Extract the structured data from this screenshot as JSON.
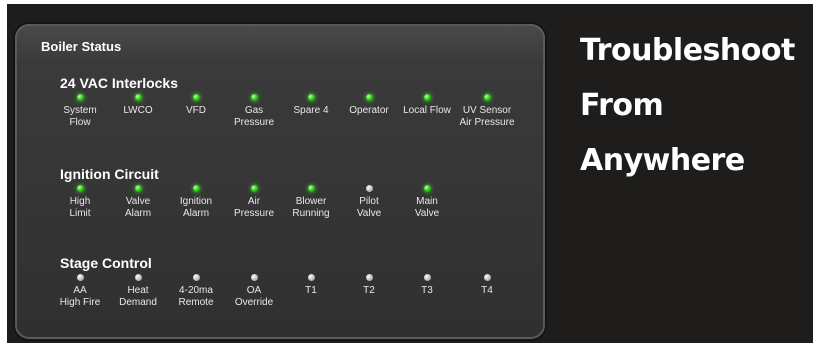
{
  "panel": {
    "title": "Boiler Status",
    "sections": [
      {
        "title": "24 VAC Interlocks",
        "items": [
          {
            "label": "System\nFlow",
            "state": "on"
          },
          {
            "label": "LWCO",
            "state": "on"
          },
          {
            "label": "VFD",
            "state": "on"
          },
          {
            "label": "Gas\nPressure",
            "state": "on"
          },
          {
            "label": "Spare 4",
            "state": "on"
          },
          {
            "label": "Operator",
            "state": "on"
          },
          {
            "label": "Local Flow",
            "state": "on"
          },
          {
            "label": "UV Sensor\nAir Pressure",
            "state": "on"
          }
        ]
      },
      {
        "title": "Ignition Circuit",
        "items": [
          {
            "label": "High\nLimit",
            "state": "on"
          },
          {
            "label": "Valve\nAlarm",
            "state": "on"
          },
          {
            "label": "Ignition\nAlarm",
            "state": "on"
          },
          {
            "label": "Air\nPressure",
            "state": "on"
          },
          {
            "label": "Blower\nRunning",
            "state": "on"
          },
          {
            "label": "Pilot\nValve",
            "state": "off"
          },
          {
            "label": "Main\nValve",
            "state": "on"
          }
        ]
      },
      {
        "title": "Stage Control",
        "items": [
          {
            "label": "AA\nHigh Fire",
            "state": "off"
          },
          {
            "label": "Heat\nDemand",
            "state": "off"
          },
          {
            "label": "4-20ma\nRemote",
            "state": "off"
          },
          {
            "label": "OA\nOverride",
            "state": "off"
          },
          {
            "label": "T1",
            "state": "off"
          },
          {
            "label": "T2",
            "state": "off"
          },
          {
            "label": "T3",
            "state": "off"
          },
          {
            "label": "T4",
            "state": "off"
          }
        ]
      }
    ]
  },
  "hero": {
    "lines": [
      "Troubleshoot",
      "From",
      "Anywhere"
    ]
  },
  "colors": {
    "led_on": "#33d21c",
    "led_off": "#c8c8c8",
    "background": "#1e1d1b"
  }
}
